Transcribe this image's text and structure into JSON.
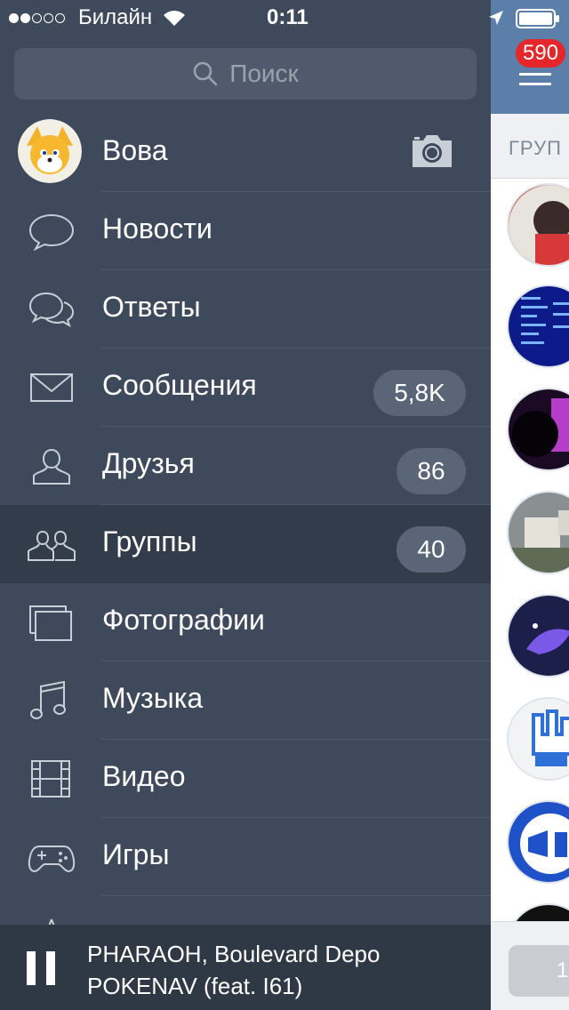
{
  "status_bar": {
    "carrier": "Билайн",
    "time": "0:11",
    "signal_strength": 2,
    "signal_max": 5
  },
  "search": {
    "placeholder": "Поиск"
  },
  "profile": {
    "name": "Вова"
  },
  "menu": {
    "items": [
      {
        "label": "Новости",
        "icon": "news-bubble-icon"
      },
      {
        "label": "Ответы",
        "icon": "replies-bubbles-icon"
      },
      {
        "label": "Сообщения",
        "icon": "envelope-icon",
        "badge": "5,8K"
      },
      {
        "label": "Друзья",
        "icon": "person-icon",
        "badge": "86"
      },
      {
        "label": "Группы",
        "icon": "people-icon",
        "badge": "40",
        "active": true
      },
      {
        "label": "Фотографии",
        "icon": "photos-icon"
      },
      {
        "label": "Музыка",
        "icon": "music-note-icon"
      },
      {
        "label": "Видео",
        "icon": "film-icon"
      },
      {
        "label": "Игры",
        "icon": "gamepad-icon"
      }
    ]
  },
  "player": {
    "artist": "PHARAOH, Boulevard Depo",
    "title": "POKENAV (feat. I61)",
    "state": "playing",
    "control_icon": "pause-icon"
  },
  "right_panel": {
    "badge": "590",
    "tab_label": "ГРУП",
    "bottom_button": "1"
  },
  "colors": {
    "menu_bg": "#3e4a5c",
    "active_row_bg": "#333c4b",
    "header_blue": "#5b7fa8",
    "badge_red": "#e5262b"
  }
}
